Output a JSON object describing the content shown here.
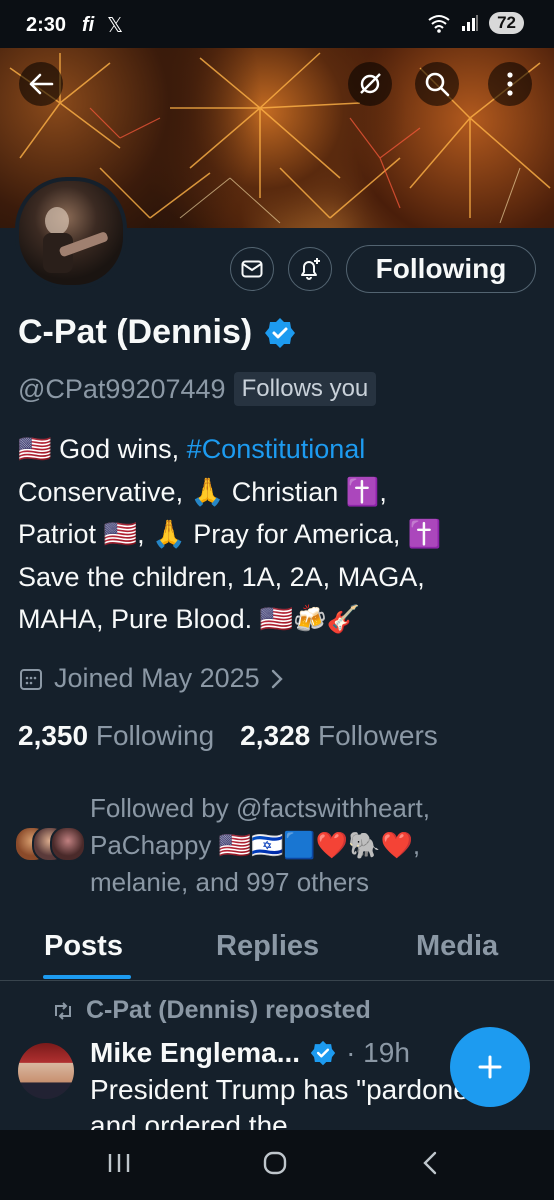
{
  "status_bar": {
    "time": "2:30",
    "app1": "fi",
    "app2": "𝕏",
    "battery": "72"
  },
  "header": {
    "back_icon": "arrow-left-icon",
    "grok_icon": "grok-icon",
    "search_icon": "search-icon",
    "more_icon": "more-vertical-icon"
  },
  "profile": {
    "name": "C-Pat (Dennis)",
    "handle": "@CPat99207449",
    "follows_you": "Follows you",
    "follow_button": "Following",
    "bio": {
      "l1a": "🇺🇸 God wins, ",
      "l1tag": "#Constitutional",
      "l2": "Conservative, 🙏 Christian ✝️,",
      "l3": "Patriot 🇺🇸, 🙏 Pray for America, ✝️",
      "l4": "Save the children, 1A, 2A, MAGA,",
      "l5": "MAHA, Pure Blood. 🇺🇸🍻🎸"
    },
    "joined": "Joined May 2025",
    "following_count": "2,350",
    "following_label": "Following",
    "followers_count": "2,328",
    "followers_label": "Followers",
    "followed_by": {
      "l1": "Followed by @factswithheart,",
      "l2": "PaChappy 🇺🇸🇮🇱🟦❤️🐘❤️,",
      "l3": "melanie, and 997 others"
    }
  },
  "tabs": [
    "Posts",
    "Replies",
    "Media"
  ],
  "post": {
    "repost_label": "C-Pat (Dennis) reposted",
    "author": "Mike Englema...",
    "time": "· 19h",
    "text": "President Trump has \"pardoned\" and ordered the"
  },
  "colors": {
    "accent": "#1d9bf0",
    "background": "#15202b",
    "muted": "#8b98a5"
  }
}
